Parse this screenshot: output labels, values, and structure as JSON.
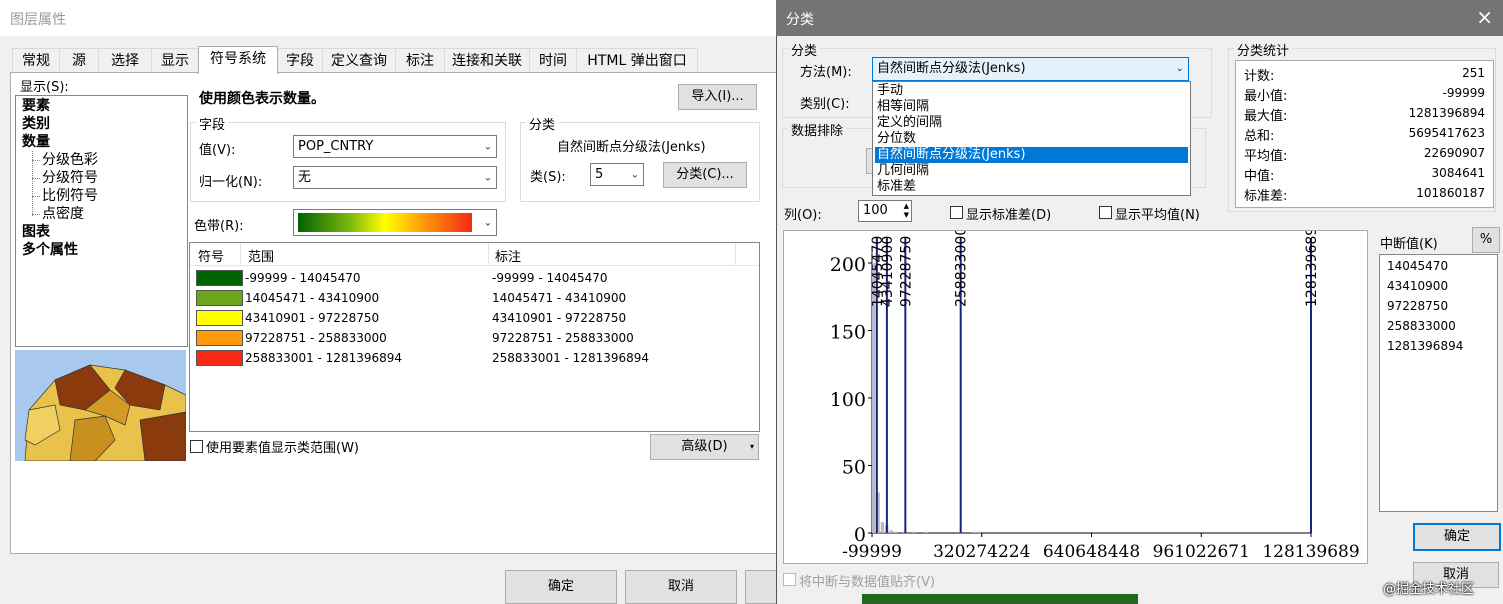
{
  "layer_props": {
    "title": "图层属性",
    "tabs": [
      "常规",
      "源",
      "选择",
      "显示",
      "符号系统",
      "字段",
      "定义查询",
      "标注",
      "连接和关联",
      "时间",
      "HTML 弹出窗口"
    ],
    "show_label": "显示(S):",
    "tree": [
      {
        "label": "要素",
        "bold": true,
        "indent": 0
      },
      {
        "label": "类别",
        "bold": true,
        "indent": 0
      },
      {
        "label": "数量",
        "bold": true,
        "indent": 0
      },
      {
        "label": "分级色彩",
        "bold": false,
        "indent": 1
      },
      {
        "label": "分级符号",
        "bold": false,
        "indent": 1
      },
      {
        "label": "比例符号",
        "bold": false,
        "indent": 1
      },
      {
        "label": "点密度",
        "bold": false,
        "indent": 1
      },
      {
        "label": "图表",
        "bold": true,
        "indent": 0
      },
      {
        "label": "多个属性",
        "bold": true,
        "indent": 0
      }
    ],
    "heading": "使用颜色表示数量。",
    "import_button": "导入(I)...",
    "field_group": "字段",
    "value_label": "值(V):",
    "value": "POP_CNTRY",
    "normalize_label": "归一化(N):",
    "normalize": "无",
    "classify_group": "分类",
    "classify_method": "自然间断点分级法(Jenks)",
    "classes_label": "类(S):",
    "classes_value": "5",
    "classify_button": "分类(C)...",
    "ramp_label": "色带(R):",
    "table_headers": [
      "符号",
      "范围",
      "标注"
    ],
    "rows": [
      {
        "color": "#006400",
        "range": "-99999 - 14045470",
        "label": "-99999 - 14045470"
      },
      {
        "color": "#6aa51c",
        "range": "14045471 - 43410900",
        "label": "14045471 - 43410900"
      },
      {
        "color": "#ffff00",
        "range": "43410901 - 97228750",
        "label": "43410901 - 97228750"
      },
      {
        "color": "#ff9a0a",
        "range": "97228751 - 258833000",
        "label": "97228751 - 258833000"
      },
      {
        "color": "#f52914",
        "range": "258833001 - 1281396894",
        "label": "258833001 - 1281396894"
      }
    ],
    "use_feature_values": "使用要素值显示类范围(W)",
    "advanced_button": "高级(D)",
    "ok_button": "确定",
    "cancel_button": "取消"
  },
  "classify": {
    "title": "分类",
    "close_icon": "×",
    "group_label": "分类",
    "method_label": "方法(M):",
    "method_value": "自然间断点分级法(Jenks)",
    "classes_label": "类别(C):",
    "methods": [
      "手动",
      "相等间隔",
      "定义的间隔",
      "分位数",
      "自然间断点分级法(Jenks)",
      "几何间隔",
      "标准差"
    ],
    "selected_method_index": 4,
    "exclusion_label": "数据排除",
    "columns_label": "列(O):",
    "columns_value": "100",
    "show_std": "显示标准差(D)",
    "show_mean": "显示平均值(N)",
    "stats_group": "分类统计",
    "stats": [
      {
        "label": "计数:",
        "value": "251"
      },
      {
        "label": "最小值:",
        "value": "-99999"
      },
      {
        "label": "最大值:",
        "value": "1281396894"
      },
      {
        "label": "总和:",
        "value": "5695417623"
      },
      {
        "label": "平均值:",
        "value": "22690907"
      },
      {
        "label": "中值:",
        "value": "3084641"
      },
      {
        "label": "标准差:",
        "value": "101860187"
      }
    ],
    "breaks_label": "中断值(K)",
    "percent_button": "%",
    "breaks": [
      "14045470",
      "43410900",
      "97228750",
      "258833000",
      "1281396894"
    ],
    "snap_label": "将中断与数据值贴齐(V)",
    "ok_button": "确定",
    "cancel_button": "取消",
    "watermark": "@掘金技术社区"
  },
  "chart_data": {
    "type": "bar",
    "title": "",
    "xlabel": "",
    "ylabel": "",
    "x_ticks": [
      "-99999",
      "320274224",
      "640648448",
      "961022671",
      "128139689"
    ],
    "y_ticks": [
      "0",
      "50",
      "100",
      "150",
      "200"
    ],
    "xlim": [
      -99999,
      1281396894
    ],
    "ylim": [
      0,
      200
    ],
    "histogram_bins": [
      {
        "x": 0,
        "count": 200
      },
      {
        "x": 1,
        "count": 30
      },
      {
        "x": 2,
        "count": 8
      },
      {
        "x": 3,
        "count": 6
      },
      {
        "x": 4,
        "count": 2
      },
      {
        "x": 5,
        "count": 1
      },
      {
        "x": 7,
        "count": 1
      },
      {
        "x": 9,
        "count": 1
      },
      {
        "x": 12,
        "count": 1
      },
      {
        "x": 23,
        "count": 1
      },
      {
        "x": 24,
        "count": 1
      }
    ],
    "break_values": [
      14045470,
      43410900,
      97228750,
      258833000,
      1281396894
    ],
    "break_labels": [
      "14045470",
      "43410900",
      "97228750",
      "258833000",
      "1281396894"
    ]
  }
}
